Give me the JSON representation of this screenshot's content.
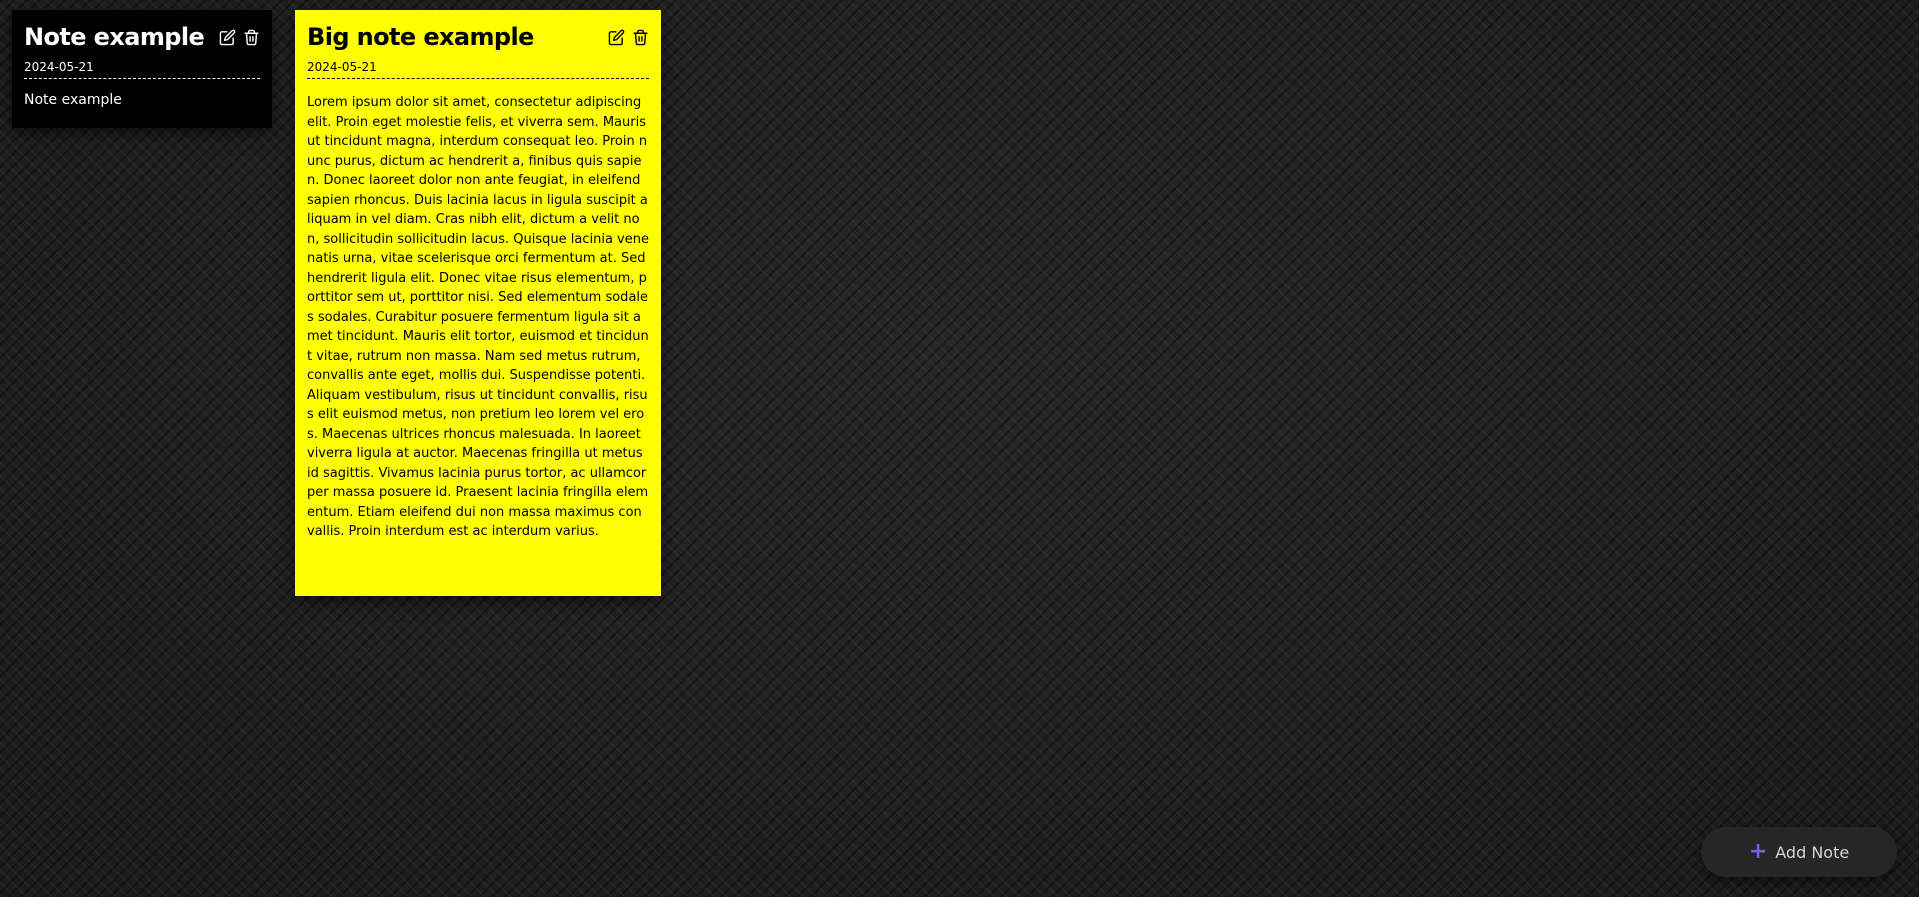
{
  "notes": [
    {
      "title": "Note example",
      "date": "2024-05-21",
      "body": "Note example",
      "background": "#000000",
      "text_color": "#ffffff",
      "actions": [
        "edit-icon",
        "trash-icon"
      ]
    },
    {
      "title": "Big note example",
      "date": "2024-05-21",
      "body": "Lorem ipsum dolor sit amet, consectetur adipiscing elit. Proin eget molestie felis, et viverra sem. Mauris ut tincidunt magna, interdum consequat leo. Proin nunc purus, dictum ac hendrerit a, finibus quis sapien. Donec laoreet dolor non ante feugiat, in eleifend sapien rhoncus. Duis lacinia lacus in ligula suscipit aliquam in vel diam. Cras nibh elit, dictum a velit non, sollicitudin sollicitudin lacus. Quisque lacinia venenatis urna, vitae scelerisque orci fermentum at. Sed hendrerit ligula elit. Donec vitae risus elementum, porttitor sem ut, porttitor nisi. Sed elementum sodales sodales. Curabitur posuere fermentum ligula sit amet tincidunt. Mauris elit tortor, euismod et tincidunt vitae, rutrum non massa. Nam sed metus rutrum, convallis ante eget, mollis dui. Suspendisse potenti. Aliquam vestibulum, risus ut tincidunt convallis, risus elit euismod metus, non pretium leo lorem vel eros. Maecenas ultrices rhoncus malesuada. In laoreet viverra ligula at auctor. Maecenas fringilla ut metus id sagittis. Vivamus lacinia purus tortor, ac ullamcorper massa posuere id. Praesent lacinia fringilla elementum. Etiam eleifend dui non massa maximus convallis. Proin interdum est ac interdum varius.",
      "background": "#ffff00",
      "text_color": "#000000",
      "actions": [
        "edit-icon",
        "trash-icon"
      ]
    }
  ],
  "add_button": {
    "label": "Add Note",
    "icon": "plus-icon",
    "icon_glyph": "+",
    "accent": "#7b5cf0"
  }
}
